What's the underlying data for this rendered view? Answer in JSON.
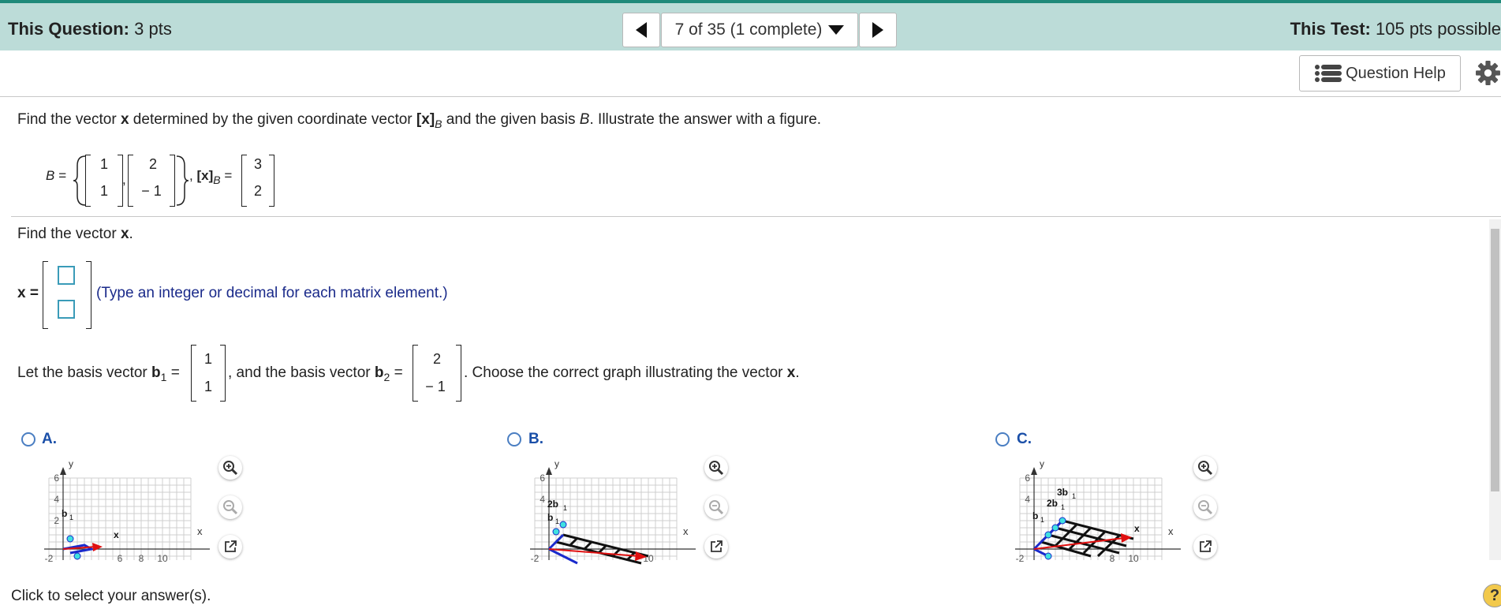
{
  "header": {
    "question_label": "This Question:",
    "question_value": "3 pts",
    "nav_status": "7 of 35 (1 complete)",
    "test_label": "This Test:",
    "test_value": "105 pts possible"
  },
  "toolbar": {
    "help_label": "Question Help"
  },
  "problem": {
    "prompt_1": "Find the vector ",
    "prompt_bold_x": "x",
    "prompt_2": " determined by the given coordinate vector ",
    "prompt_coord": "[x]",
    "prompt_sub": "B",
    "prompt_3": " and the given basis ",
    "prompt_basis": "B",
    "prompt_4": ". Illustrate the answer with a figure.",
    "basis_label": "B =",
    "basis_v1": [
      "1",
      "1"
    ],
    "basis_v2": [
      "2",
      "− 1"
    ],
    "coord_label": "[x]",
    "coord_sub": "B",
    "coord_eq": "=",
    "coord_vals": [
      "3",
      "2"
    ]
  },
  "part1": {
    "instruction_1": "Find the vector ",
    "instruction_bold": "x",
    "instruction_2": ".",
    "answer_label": "x =",
    "hint": "(Type an integer or decimal for each matrix element.)"
  },
  "part2": {
    "text_1": "Let the basis vector ",
    "b1_label": "b",
    "b1_sub": "1",
    "eq": "=",
    "b1_vals": [
      "1",
      "1"
    ],
    "text_2": ", and the basis vector ",
    "b2_label": "b",
    "b2_sub": "2",
    "b2_vals": [
      "2",
      "− 1"
    ],
    "text_3": ". Choose the correct graph illustrating the vector ",
    "text_bold": "x",
    "text_4": "."
  },
  "options": [
    {
      "letter": "A."
    },
    {
      "letter": "B."
    },
    {
      "letter": "C."
    }
  ],
  "graph_labels": {
    "y": "y",
    "x": "x",
    "ticks_x": [
      "-2",
      "4",
      "6",
      "8",
      "10"
    ],
    "ticks_y": [
      "6",
      "4",
      "2"
    ],
    "b1": "b",
    "sub1": "1",
    "two_b1": "2b",
    "three_b1": "3b",
    "vec_x": "x"
  },
  "footer": {
    "instruction": "Click to select your answer(s).",
    "help": "?"
  },
  "colors": {
    "accent": "#1f8a7a",
    "header_bg": "#bcdcd8",
    "link": "#1a4fa8",
    "basis_line": "#1a2acc",
    "answer_vec": "#e01010"
  }
}
